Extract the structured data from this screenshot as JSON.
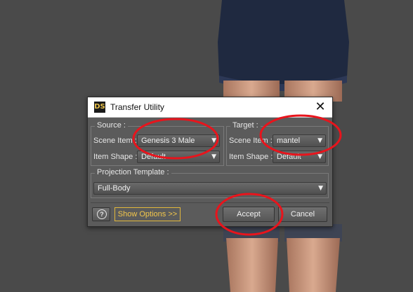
{
  "dialog": {
    "title": "Transfer Utility",
    "app_icon_text": "DS",
    "source": {
      "group_label": "Source :",
      "scene_item_label": "Scene Item :",
      "scene_item_value": "Genesis 3 Male",
      "item_shape_label": "Item Shape :",
      "item_shape_value": "Default"
    },
    "target": {
      "group_label": "Target :",
      "scene_item_label": "Scene Item :",
      "scene_item_value": "mantel",
      "item_shape_label": "Item Shape :",
      "item_shape_value": "Default"
    },
    "projection": {
      "group_label": "Projection Template :",
      "value": "Full-Body"
    },
    "buttons": {
      "help_glyph": "?",
      "show_options": "Show Options >>",
      "accept": "Accept",
      "cancel": "Cancel"
    }
  },
  "colors": {
    "annotation_red": "#e8141c",
    "show_options_accent": "#f3c74b",
    "scene_background": "#4a4a4a"
  }
}
